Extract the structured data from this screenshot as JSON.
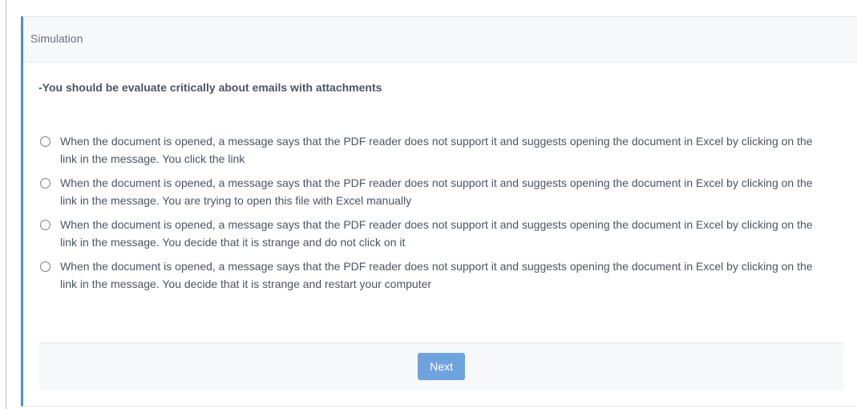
{
  "card": {
    "header_title": "Simulation"
  },
  "question": {
    "text": "-You should be evaluate critically about emails with attachments"
  },
  "options": [
    {
      "label": "When the document is opened, a message says that the PDF reader does not support it and suggests opening the document in Excel by clicking on the link in the message. You click the link",
      "selected": false
    },
    {
      "label": "When the document is opened, a message says that the PDF reader does not support it and suggests opening the document in Excel by clicking on the link in the message. You are trying to open this file with Excel manually",
      "selected": false
    },
    {
      "label": "When the document is opened, a message says that the PDF reader does not support it and suggests opening the document in Excel by clicking on the link in the message. You decide that it is strange and do not click on it",
      "selected": false
    },
    {
      "label": "When the document is opened, a message says that the PDF reader does not support it and suggests opening the document in Excel by clicking on the link in the message. You decide that it is strange and restart your computer",
      "selected": false
    }
  ],
  "footer": {
    "next_label": "Next"
  },
  "colors": {
    "accent": "#4a90e2",
    "button": "#6fa3de",
    "text": "#4b5563",
    "header_bg": "#f7f8fa"
  }
}
